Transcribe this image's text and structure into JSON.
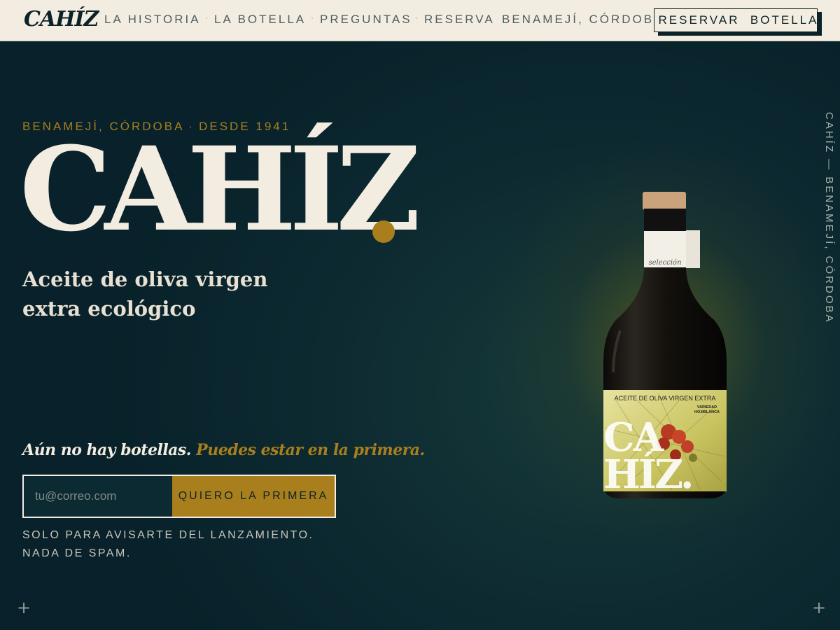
{
  "nav": {
    "logo": "CAHÍZ",
    "links": [
      "LA HISTORIA",
      "LA BOTELLA",
      "PREGUNTAS",
      "RESERVA"
    ],
    "location": "BENAMEJÍ, CÓRDOBA",
    "reserve_button": "RESERVAR  BOTELLA",
    "separator": "·"
  },
  "hero": {
    "eyebrow_location": "BENAMEJÍ, CÓRDOBA",
    "eyebrow_since": "DESDE 1941",
    "eyebrow_separator": "·",
    "title": "CAHÍZ",
    "subtitle_line1": "Aceite de oliva virgen",
    "subtitle_line2": "extra ecológico",
    "teaser_part1": "Aún no hay botellas.",
    "teaser_part2": "Puedes estar en la primera.",
    "email_placeholder": "tu@correo.com",
    "cta_label": "QUIERO LA PRIMERA",
    "note_line1": "SOLO PARA AVISARTE DEL LANZAMIENTO.",
    "note_line2": "NADA DE SPAM.",
    "vertical_label": "CAHÍZ — BENAMEJÍ, CÓRDOBA",
    "corner_mark": "+"
  },
  "bottle": {
    "neck_tag": "selección",
    "label_top": "ACEITE DE OLIVA VIRGEN EXTRA",
    "variety_1": "VARIEDAD",
    "variety_2": "HOJIBLANCA",
    "label_word_1": "CA",
    "label_word_2": "HÍZ."
  },
  "colors": {
    "cream": "#f3ede1",
    "deep_teal": "#0a242b",
    "gold": "#a87f1c",
    "accent_red": "#c45a2f"
  }
}
